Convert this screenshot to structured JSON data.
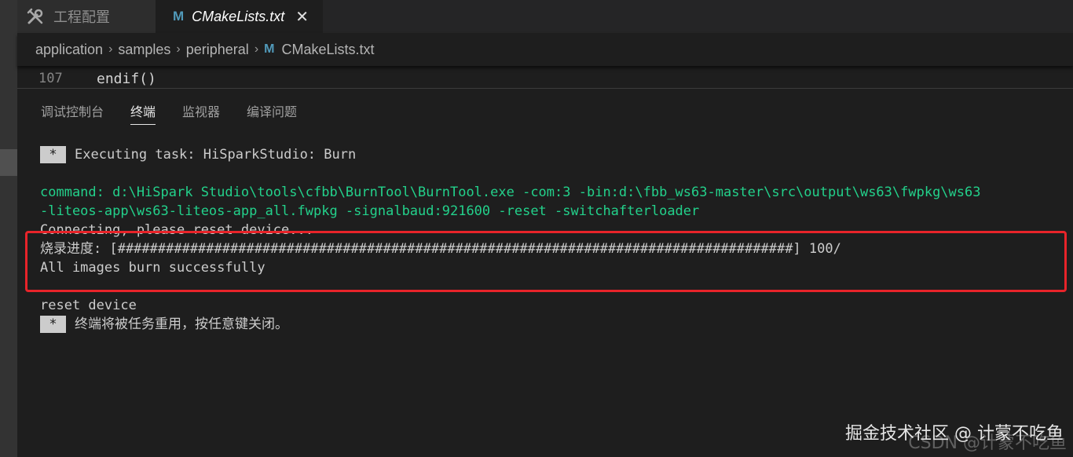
{
  "tabs": [
    {
      "label": "工程配置",
      "icon": "tools-icon",
      "active": false
    },
    {
      "label": "CMakeLists.txt",
      "icon": "cmake-m-icon",
      "icon_glyph": "M",
      "active": true,
      "close_glyph": "✕"
    }
  ],
  "breadcrumb": {
    "items": [
      "application",
      "samples",
      "peripheral",
      "CMakeLists.txt"
    ],
    "separator": "›",
    "file_icon_glyph": "M"
  },
  "editor": {
    "line_number": "107",
    "line_code": "endif()"
  },
  "panel": {
    "tabs": [
      "调试控制台",
      "终端",
      "监视器",
      "编译问题"
    ],
    "active_tab": "终端"
  },
  "terminal": {
    "star": "*",
    "executing": "Executing task: HiSparkStudio: Burn",
    "command_line1": "command: d:\\HiSpark Studio\\tools\\cfbb\\BurnTool\\BurnTool.exe -com:3 -bin:d:\\fbb_ws63-master\\src\\output\\ws63\\fwpkg\\ws63",
    "command_line2": "-liteos-app\\ws63-liteos-app_all.fwpkg -signalbaud:921600 -reset -switchafterloader",
    "connecting": "Connecting, please reset device...",
    "progress": "烧录进度: [####################################################################################] 100/",
    "progress_value": 100,
    "success": "All images burn successfully",
    "reset": "reset device",
    "reuse": "终端将被任务重用，按任意键关闭。"
  },
  "colors": {
    "accent_green": "#23d18b",
    "highlight_red": "#e8242a",
    "cmake_blue": "#519aba"
  },
  "watermark": {
    "main": "掘金技术社区 @ 计蒙不吃鱼",
    "faint": "CSDN @计蒙不吃鱼"
  }
}
